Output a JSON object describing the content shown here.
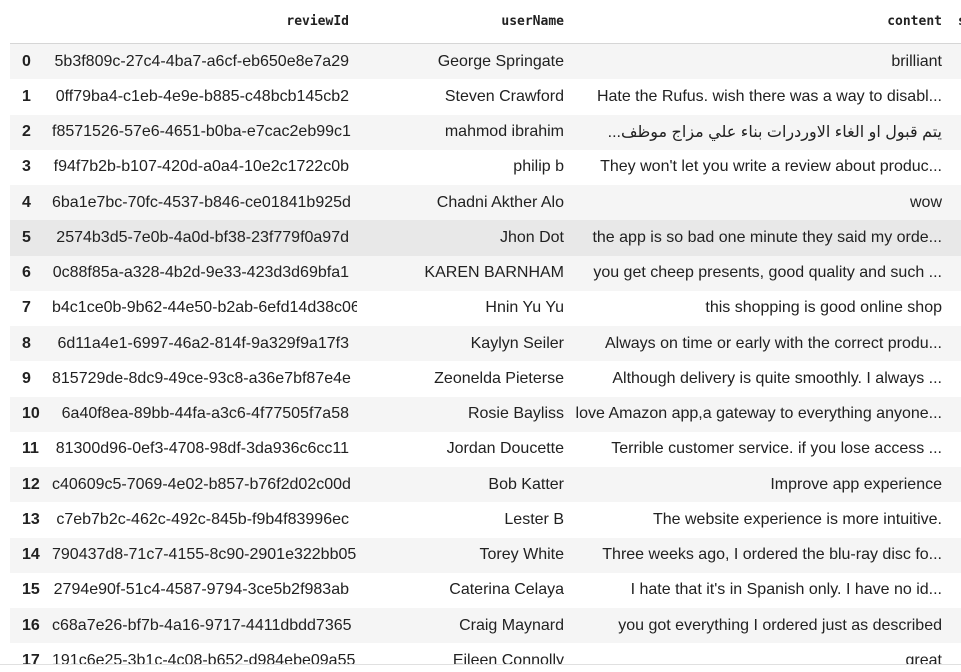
{
  "table": {
    "columns": [
      "reviewId",
      "userName",
      "content",
      "s"
    ],
    "rows": [
      {
        "index": "0",
        "reviewId": "5b3f809c-27c4-4ba7-a6cf-eb650e8e7a29",
        "userName": "George Springate",
        "content": "brilliant"
      },
      {
        "index": "1",
        "reviewId": "0ff79ba4-c1eb-4e9e-b885-c48bcb145cb2",
        "userName": "Steven Crawford",
        "content": "Hate the Rufus. wish there was a way to disabl..."
      },
      {
        "index": "2",
        "reviewId": "f8571526-57e6-4651-b0ba-e7cac2eb99c1",
        "userName": "mahmod ibrahim",
        "content": "يتم قبول او الغاء الاوردرات بناء علي مزاج موظف..."
      },
      {
        "index": "3",
        "reviewId": "f94f7b2b-b107-420d-a0a4-10e2c1722c0b",
        "userName": "philip b",
        "content": "They won't let you write a review about produc..."
      },
      {
        "index": "4",
        "reviewId": "6ba1e7bc-70fc-4537-b846-ce01841b925d",
        "userName": "Chadni Akther Alo",
        "content": "wow"
      },
      {
        "index": "5",
        "reviewId": "2574b3d5-7e0b-4a0d-bf38-23f779f0a97d",
        "userName": "Jhon Dot",
        "content": "the app is so bad one minute they said my orde..."
      },
      {
        "index": "6",
        "reviewId": "0c88f85a-a328-4b2d-9e33-423d3d69bfa1",
        "userName": "KAREN BARNHAM",
        "content": "you get cheep presents, good quality and such ..."
      },
      {
        "index": "7",
        "reviewId": "b4c1ce0b-9b62-44e50-b2ab-6efd14d38c06",
        "userName": "Hnin Yu Yu",
        "content": "this shopping is good online shop"
      },
      {
        "index": "8",
        "reviewId": "6d11a4e1-6997-46a2-814f-9a329f9a17f3",
        "userName": "Kaylyn Seiler",
        "content": "Always on time or early with the correct produ..."
      },
      {
        "index": "9",
        "reviewId": "815729de-8dc9-49ce-93c8-a36e7bf87e4e",
        "userName": "Zeonelda Pieterse",
        "content": "Although delivery is quite smoothly. I always ..."
      },
      {
        "index": "10",
        "reviewId": "6a40f8ea-89bb-44fa-a3c6-4f77505f7a58",
        "userName": "Rosie Bayliss",
        "content": "love Amazon app,a gateway to everything anyone..."
      },
      {
        "index": "11",
        "reviewId": "81300d96-0ef3-4708-98df-3da936c6cc11",
        "userName": "Jordan Doucette",
        "content": "Terrible customer service. if you lose access ..."
      },
      {
        "index": "12",
        "reviewId": "c40609c5-7069-4e02-b857-b76f2d02c00d",
        "userName": "Bob Katter",
        "content": "Improve app experience"
      },
      {
        "index": "13",
        "reviewId": "c7eb7b2c-462c-492c-845b-f9b4f83996ec",
        "userName": "Lester B",
        "content": "The website experience is more intuitive."
      },
      {
        "index": "14",
        "reviewId": "790437d8-71c7-4155-8c90-2901e322bb05",
        "userName": "Torey White",
        "content": "Three weeks ago, I ordered the blu-ray disc fo..."
      },
      {
        "index": "15",
        "reviewId": "2794e90f-51c4-4587-9794-3ce5b2f983ab",
        "userName": "Caterina Celaya",
        "content": "I hate that it's in Spanish only. I have no id..."
      },
      {
        "index": "16",
        "reviewId": "c68a7e26-bf7b-4a16-9717-4411dbdd7365",
        "userName": "Craig Maynard",
        "content": "you got everything I ordered just as described"
      },
      {
        "index": "17",
        "reviewId": "191c6e25-3b1c-4c08-b652-d984ebe09a55",
        "userName": "Eileen Connolly",
        "content": "great"
      }
    ]
  }
}
